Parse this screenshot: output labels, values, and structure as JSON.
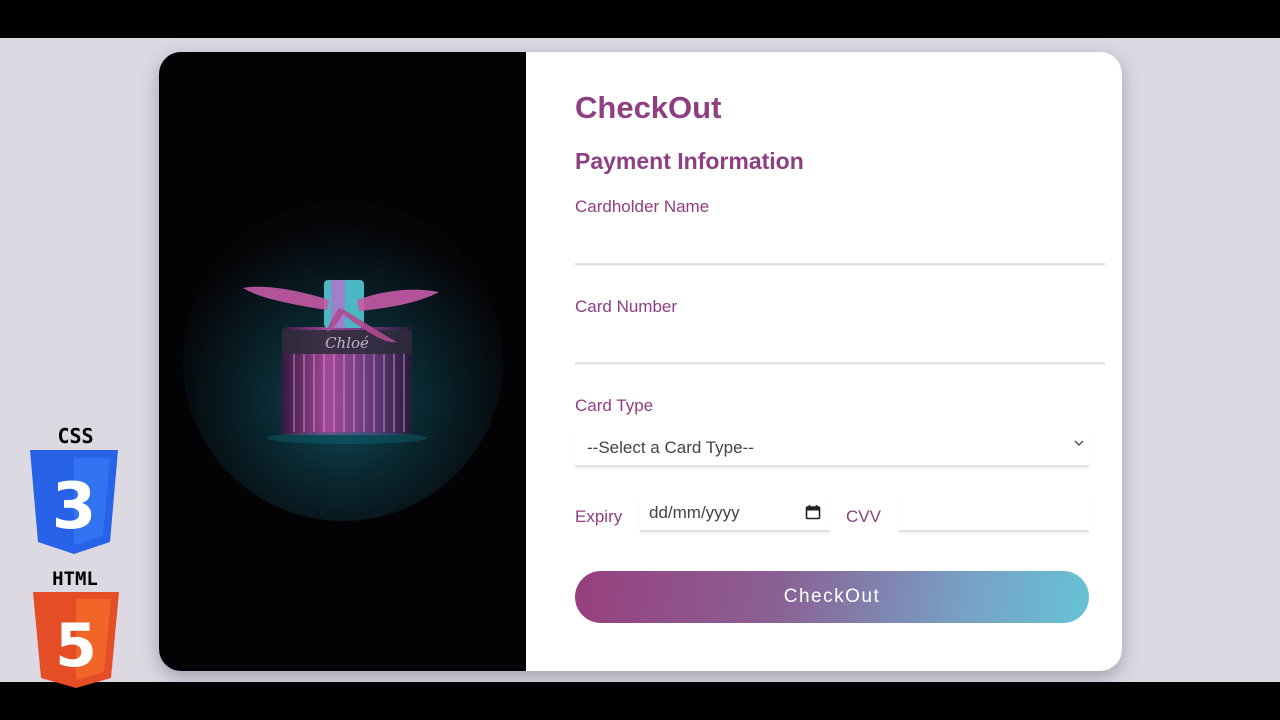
{
  "checkout": {
    "title": "CheckOut",
    "subtitle": "Payment Information",
    "cardholder_label": "Cardholder Name",
    "cardholder_value": "",
    "card_number_label": "Card Number",
    "card_number_value": "",
    "card_type_label": "Card Type",
    "card_type_selected": "--Select a Card Type--",
    "expiry_label": "Expiry",
    "expiry_placeholder": "dd/mm/yyyy",
    "cvv_label": "CVV",
    "cvv_value": "",
    "submit_label": "CheckOut"
  },
  "product_image": {
    "brand_text": "Chloé"
  },
  "logos": {
    "css_label": "CSS",
    "css_number": "3",
    "html_label": "HTML",
    "html_number": "5"
  },
  "colors": {
    "accent": "#8e3e82",
    "button_gradient_start": "#973f7e",
    "button_gradient_end": "#66c3d6",
    "page_background": "#dcd9e3",
    "css_logo": "#2762e9",
    "html_logo": "#e44d26"
  },
  "icons": [
    "chevron-down-icon",
    "calendar-icon",
    "css3-logo",
    "html5-logo"
  ]
}
